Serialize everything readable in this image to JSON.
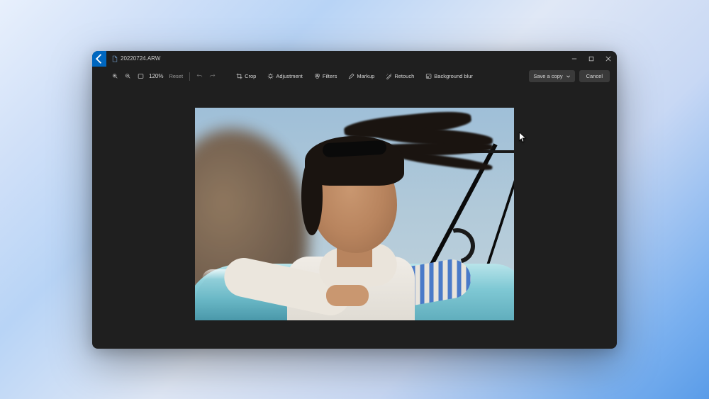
{
  "titlebar": {
    "filename": "20220724.ARW"
  },
  "toolbar": {
    "zoom_level": "120%",
    "reset_label": "Reset",
    "crop_label": "Crop",
    "adjustment_label": "Adjustment",
    "filters_label": "Filters",
    "markup_label": "Markup",
    "retouch_label": "Retouch",
    "background_blur_label": "Background blur",
    "save_label": "Save a copy",
    "cancel_label": "Cancel"
  },
  "image": {
    "description": "Woman with dark hair blowing in wind, wearing white and blue striped sweater, leaning on teal convertible car door, smiling, blurred rocky background"
  }
}
